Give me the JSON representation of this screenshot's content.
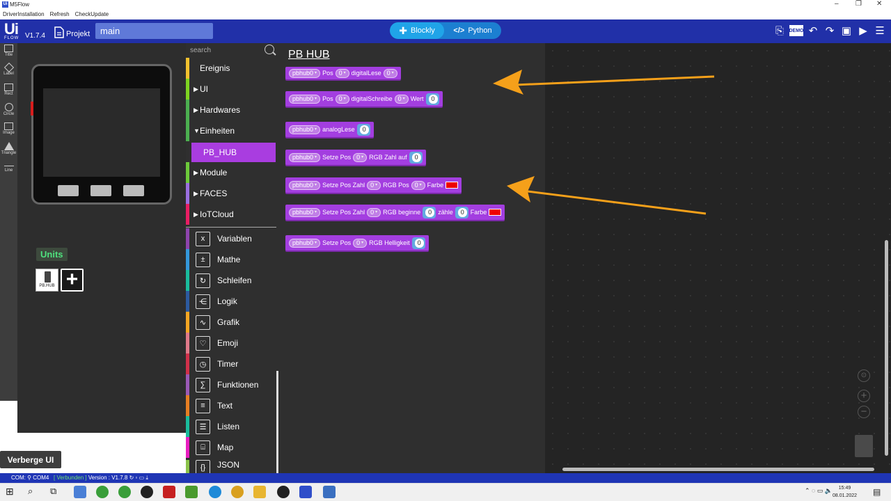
{
  "window": {
    "title": "M5Flow",
    "app_icon_text": "Ui"
  },
  "menu": [
    "DriverInstallation",
    "Refresh",
    "CheckUpdate"
  ],
  "header": {
    "logo": "Ui",
    "logo_sub": "FLOW",
    "version": "V1.7.4",
    "projekt_label": "Projekt",
    "project_name": "main",
    "mode_blockly": "Blockly",
    "mode_python": "Python"
  },
  "shapes": [
    "Title",
    "Label",
    "Rect",
    "Circle",
    "Image",
    "Triangle",
    "Line"
  ],
  "units": {
    "title": "Units",
    "unit_label": "PB.HUB"
  },
  "hide_ui": "Verberge UI",
  "palette": {
    "search_placeholder": "search",
    "categories": [
      {
        "label": "Ereignis",
        "arrow": "",
        "color": "#f2c12e"
      },
      {
        "label": "UI",
        "arrow": "▶",
        "color": "#7ed321"
      },
      {
        "label": "Hardwares",
        "arrow": "▶",
        "color": "#4caf50"
      },
      {
        "label": "Einheiten",
        "arrow": "▼",
        "color": "#4caf50"
      },
      {
        "label": "Module",
        "arrow": "▶",
        "color": "#6dc93a"
      },
      {
        "label": "FACES",
        "arrow": "▶",
        "color": "#9a6fe0"
      },
      {
        "label": "IoTCloud",
        "arrow": "▶",
        "color": "#e91e63"
      }
    ],
    "selected_sub": "PB_HUB",
    "categories2": [
      {
        "label": "Variablen",
        "color": "#8e44ad",
        "icon": "x"
      },
      {
        "label": "Mathe",
        "color": "#3498db",
        "icon": "±"
      },
      {
        "label": "Schleifen",
        "color": "#1abc9c",
        "icon": "↻"
      },
      {
        "label": "Logik",
        "color": "#2c5aa0",
        "icon": "⋲"
      },
      {
        "label": "Grafik",
        "color": "#f5a623",
        "icon": "∿"
      },
      {
        "label": "Emoji",
        "color": "#e07a8a",
        "icon": "♡"
      },
      {
        "label": "Timer",
        "color": "#d0304a",
        "icon": "◷"
      },
      {
        "label": "Funktionen",
        "color": "#9b59b6",
        "icon": "∑"
      },
      {
        "label": "Text",
        "color": "#e67e22",
        "icon": "≡"
      },
      {
        "label": "Listen",
        "color": "#1abc9c",
        "icon": "☰"
      },
      {
        "label": "Map",
        "color": "#e91ec0",
        "icon": "⌸"
      },
      {
        "label": "JSON",
        "color": "#8bc34a",
        "icon": "{}"
      }
    ]
  },
  "flyout": {
    "title": "PB HUB",
    "blocks": {
      "b1": {
        "dev": "pbhub0",
        "pos": "Pos",
        "p0": "0",
        "fn": "digitalLese",
        "v": "0"
      },
      "b2": {
        "dev": "pbhub0",
        "pos": "Pos",
        "p0": "0",
        "fn": "digitalSchreibe",
        "v": "0",
        "wert": "Wert",
        "n": "0"
      },
      "b3": {
        "dev": "pbhub0",
        "fn": "analogLese",
        "n": "0"
      },
      "b4": {
        "dev": "pbhub0",
        "pre": "Setze Pos",
        "p0": "0",
        "fn": "RGB Zahl auf",
        "n": "0"
      },
      "b5": {
        "dev": "pbhub0",
        "pre": "Setze Pos Zahl",
        "p0": "0",
        "fn": "RGB Pos",
        "p1": "0",
        "farbe": "Farbe",
        "color": "#e00000"
      },
      "b6": {
        "dev": "pbhub0",
        "pre": "Setze Pos Zahl",
        "p0": "0",
        "fn": "RGB beginne",
        "n1": "0",
        "z": "zähle",
        "n2": "0",
        "farbe": "Farbe",
        "color": "#e00000"
      },
      "b7": {
        "dev": "pbhub0",
        "pre": "Setze Pos",
        "p0": "0",
        "fn": "RGB Helligkeit",
        "n": "0"
      }
    }
  },
  "status": {
    "com": "COM:",
    "port": "COM4",
    "connected": "Verbunden",
    "version": "Version : V1.7.8"
  },
  "clock": {
    "time": "15:49",
    "date": "08.01.2022"
  }
}
